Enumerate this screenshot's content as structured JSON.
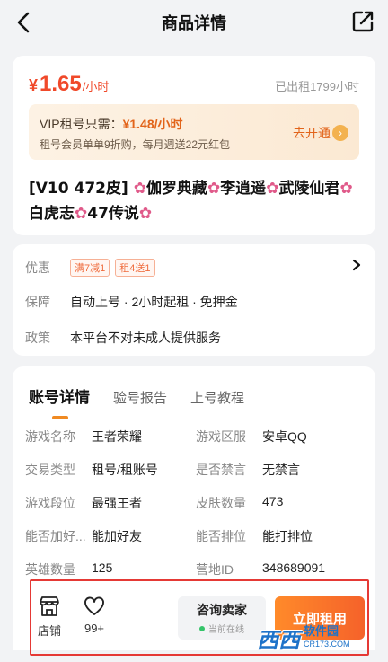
{
  "header": {
    "title": "商品详情",
    "back_icon": "chevron-left-icon",
    "share_icon": "share-icon"
  },
  "price_card": {
    "currency": "¥",
    "price": "1.65",
    "unit": "/小时",
    "rented": "已出租1799小时",
    "vip": {
      "prefix": "VIP租号只需：",
      "price": "¥1.48/小时",
      "desc": "租号会员单单9折购，每月週送22元红包",
      "cta": "去开通"
    },
    "title_parts": [
      "[V10 472皮]",
      "伽罗典藏",
      "李逍遥",
      "武陵仙君",
      "白虎志",
      "47传说"
    ],
    "flower_glyph": "✿"
  },
  "promo_card": {
    "rows": [
      {
        "label": "优惠",
        "tags": [
          "满7减1",
          "租4送1"
        ]
      },
      {
        "label": "保障",
        "value": "自动上号 · 2小时起租 · 免押金"
      },
      {
        "label": "政策",
        "value": "本平台不对未成人提供服务"
      }
    ]
  },
  "detail_card": {
    "tabs": [
      "账号详情",
      "验号报告",
      "上号教程"
    ],
    "rows": [
      [
        {
          "k": "游戏名称",
          "v": "王者荣耀"
        },
        {
          "k": "游戏区服",
          "v": "安卓QQ"
        }
      ],
      [
        {
          "k": "交易类型",
          "v": "租号/租账号"
        },
        {
          "k": "是否禁言",
          "v": "无禁言"
        }
      ],
      [
        {
          "k": "游戏段位",
          "v": "最强王者"
        },
        {
          "k": "皮肤数量",
          "v": "473"
        }
      ],
      [
        {
          "k": "能否加好...",
          "v": "能加好友"
        },
        {
          "k": "能否排位",
          "v": "能打排位"
        }
      ],
      [
        {
          "k": "英雄数量",
          "v": "125"
        },
        {
          "k": "营地ID",
          "v": "348689091"
        }
      ]
    ]
  },
  "bottom_bar": {
    "shop_label": "店铺",
    "fav_label": "99+",
    "consult_label": "咨询卖家",
    "consult_status": "当前在线",
    "rent_label": "立即租用"
  },
  "watermark": {
    "logo": "西西",
    "brand": "软件园",
    "url": "CR173.COM"
  },
  "colors": {
    "accent": "#f0492a",
    "vip_orange": "#e2641a",
    "rent_gradient_start": "#ff8a2a",
    "highlight": "#e53935"
  }
}
